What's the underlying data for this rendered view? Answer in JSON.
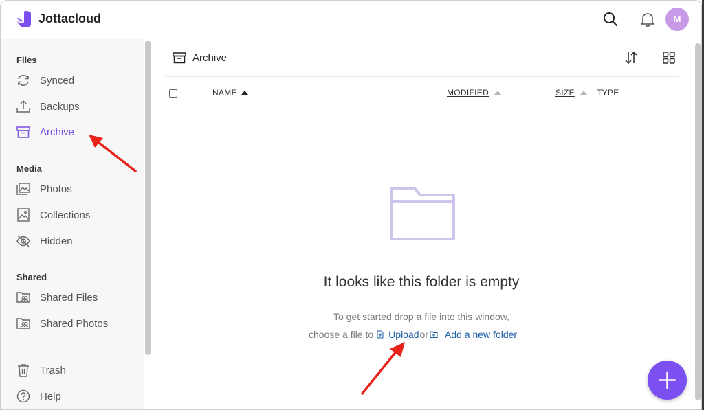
{
  "header": {
    "brand": "Jottacloud",
    "avatar_initial": "M"
  },
  "sidebar": {
    "sections": [
      {
        "title": "Files"
      },
      {
        "title": "Media"
      },
      {
        "title": "Shared"
      }
    ],
    "items": [
      {
        "label": "Synced",
        "icon": "sync-icon"
      },
      {
        "label": "Backups",
        "icon": "upload-tray-icon"
      },
      {
        "label": "Archive",
        "icon": "archive-box-icon",
        "active": true
      },
      {
        "label": "Photos",
        "icon": "photos-icon"
      },
      {
        "label": "Collections",
        "icon": "collections-icon"
      },
      {
        "label": "Hidden",
        "icon": "eye-off-icon"
      },
      {
        "label": "Shared Files",
        "icon": "shared-folder-icon"
      },
      {
        "label": "Shared Photos",
        "icon": "shared-photos-icon"
      },
      {
        "label": "Trash",
        "icon": "trash-icon"
      },
      {
        "label": "Help",
        "icon": "help-icon"
      }
    ]
  },
  "main": {
    "breadcrumb": "Archive",
    "columns": {
      "name": "NAME",
      "modified": "MODIFIED",
      "size": "SIZE",
      "type": "TYPE"
    },
    "empty": {
      "title": "It looks like this folder is empty",
      "line1": "To get started drop a file into this window,",
      "prefix": "choose a file to",
      "upload": "Upload",
      "or": "or",
      "new_folder": "Add a new folder"
    }
  },
  "colors": {
    "accent": "#7b4ff0",
    "active_text": "#7a4fe6",
    "link": "#1f5fa8",
    "annotation_arrow": "#e8231b"
  }
}
